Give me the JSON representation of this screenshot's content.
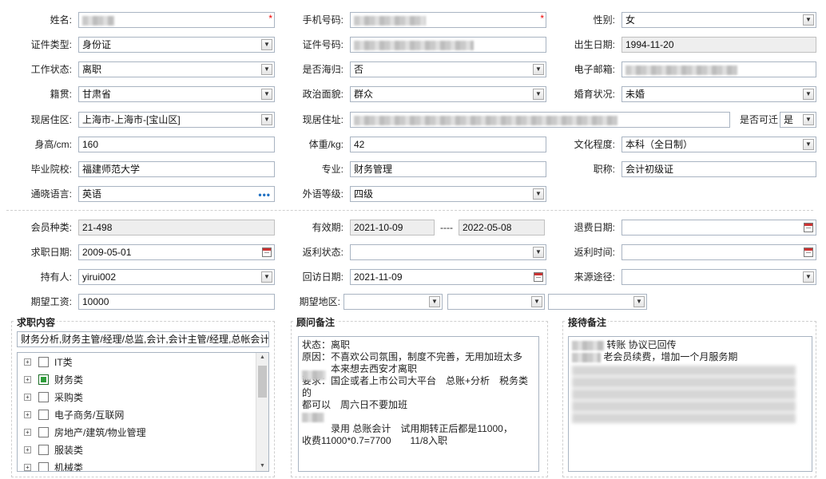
{
  "form": {
    "name": {
      "label": "姓名:",
      "value": ""
    },
    "phone": {
      "label": "手机号码:",
      "value": ""
    },
    "gender": {
      "label": "性别:",
      "value": "女"
    },
    "id_type": {
      "label": "证件类型:",
      "value": "身份证"
    },
    "id_no": {
      "label": "证件号码:",
      "value": ""
    },
    "birth": {
      "label": "出生日期:",
      "value": "1994-11-20"
    },
    "work_status": {
      "label": "工作状态:",
      "value": "离职"
    },
    "returnee": {
      "label": "是否海归:",
      "value": "否"
    },
    "email": {
      "label": "电子邮箱:",
      "value": ""
    },
    "native": {
      "label": "籍贯:",
      "value": "甘肃省"
    },
    "politics": {
      "label": "政治面貌:",
      "value": "群众"
    },
    "marital": {
      "label": "婚育状况:",
      "value": "未婚"
    },
    "residence_area": {
      "label": "现居住区:",
      "value": "上海市-上海市-[宝山区]"
    },
    "address": {
      "label": "现居住址:",
      "value": ""
    },
    "relocate": {
      "label": "是否可迁",
      "value": "是"
    },
    "height": {
      "label": "身高/cm:",
      "value": "160"
    },
    "weight": {
      "label": "体重/kg:",
      "value": "42"
    },
    "education": {
      "label": "文化程度:",
      "value": "本科（全日制）"
    },
    "school": {
      "label": "毕业院校:",
      "value": "福建师范大学"
    },
    "major": {
      "label": "专业:",
      "value": "财务管理"
    },
    "title": {
      "label": "职称:",
      "value": "会计初级证"
    },
    "language": {
      "label": "通晓语言:",
      "value": "英语",
      "more": "•••"
    },
    "lang_level": {
      "label": "外语等级:",
      "value": "四级"
    }
  },
  "member": {
    "type": {
      "label": "会员种类:",
      "value": "21-498"
    },
    "valid": {
      "label": "有效期:",
      "from": "2021-10-09",
      "sep": "----",
      "to": "2022-05-08"
    },
    "refund_date": {
      "label": "退费日期:",
      "value": ""
    },
    "apply_date": {
      "label": "求职日期:",
      "value": "2009-05-01"
    },
    "rebate_status": {
      "label": "返利状态:",
      "value": ""
    },
    "rebate_time": {
      "label": "返利时间:",
      "value": ""
    },
    "holder": {
      "label": "持有人:",
      "value": "yirui002"
    },
    "visit_date": {
      "label": "回访日期:",
      "value": "2021-11-09"
    },
    "source": {
      "label": "来源途径:",
      "value": ""
    },
    "salary": {
      "label": "期望工资:",
      "value": "10000"
    },
    "region": {
      "label": "期望地区:",
      "v1": "",
      "v2": "",
      "v3": ""
    }
  },
  "job_content": {
    "title": "求职内容",
    "summary": "财务分析,财务主管/经理/总监,会计,会计主管/经理,总帐会计",
    "tree": [
      {
        "label": "IT类",
        "checked": false
      },
      {
        "label": "财务类",
        "checked": true
      },
      {
        "label": "采购类",
        "checked": false
      },
      {
        "label": "电子商务/互联网",
        "checked": false
      },
      {
        "label": "房地产/建筑/物业管理",
        "checked": false
      },
      {
        "label": "服装类",
        "checked": false
      },
      {
        "label": "机械类",
        "checked": false
      }
    ]
  },
  "advisor_notes": {
    "title": "顾问备注",
    "text1": "状态：离职\n原因：不喜欢公司氛围，制度不完善，无用加班太多\n　　　本来想去西安才离职\n要求：国企或者上市公司大平台　总账+分析　税务类的\n都可以　周六日不要加班\n\n",
    "text2": "　　　录用 总账会计　试用期转正后都是11000，\n收费11000*0.7=7700　　11/8入职"
  },
  "reception_notes": {
    "title": "接待备注",
    "line1": "转账 协议已回传",
    "line2": "老会员续费，增加一个月服务期"
  },
  "icons": {
    "dropdown": "chevron-down-icon",
    "calendar": "calendar-icon",
    "required": "asterisk-icon",
    "expand": "plus-icon"
  }
}
